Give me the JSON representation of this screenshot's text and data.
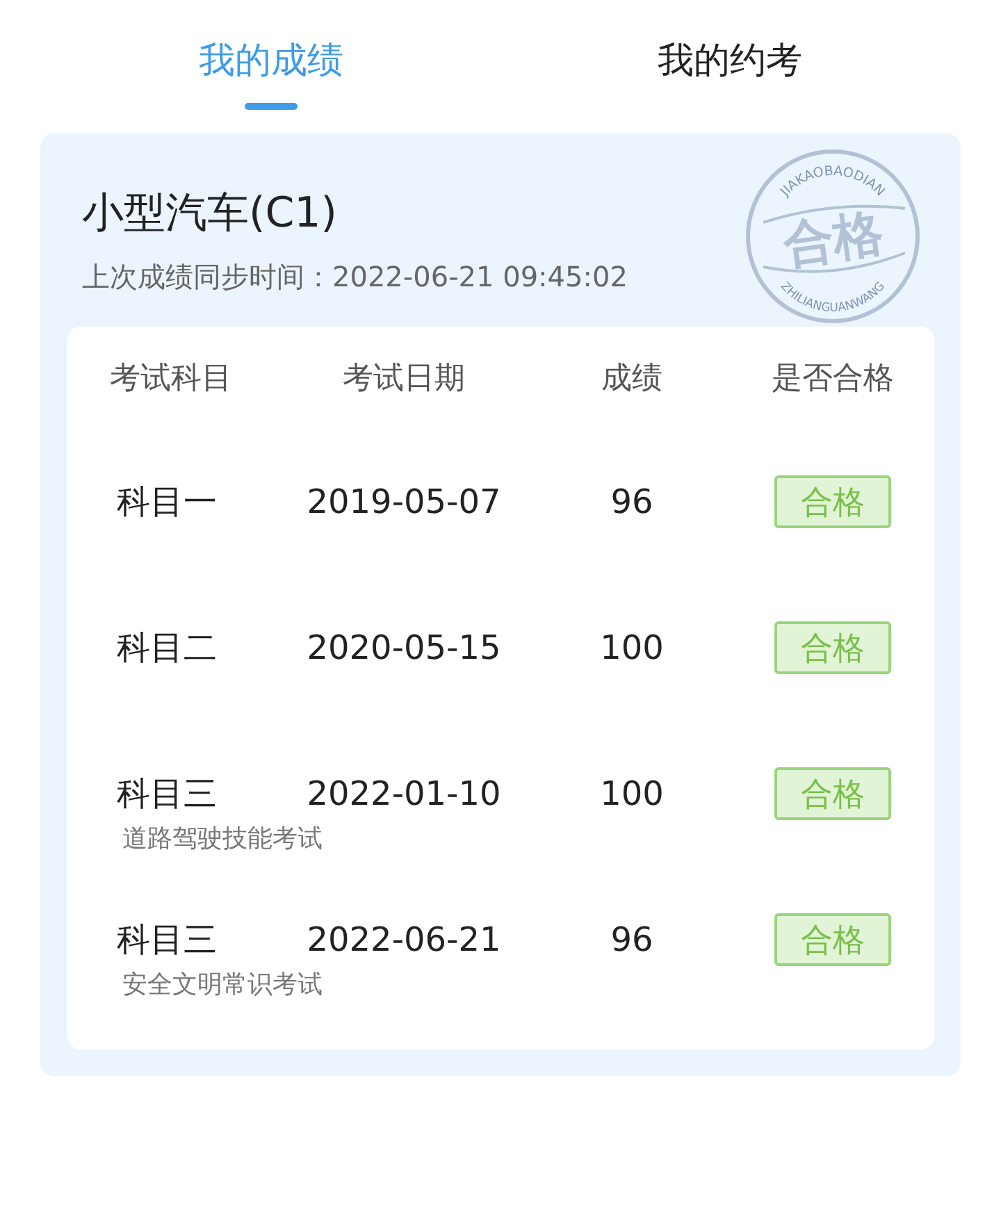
{
  "tabs": [
    {
      "label": "我的成绩",
      "selected": true
    },
    {
      "label": "我的约考",
      "selected": false
    }
  ],
  "card": {
    "title": "小型汽车(C1)",
    "sync_text": "上次成绩同步时间：2022-06-21 09:45:02",
    "stamp": {
      "top_text": "JIAKAOBAODIAN",
      "center_text": "合格",
      "bottom_text": "ZHILIANGUANWANG"
    }
  },
  "table": {
    "columns": [
      "考试科目",
      "考试日期",
      "成绩",
      "是否合格"
    ],
    "rows": [
      {
        "subject": "科目一",
        "date": "2019-05-07",
        "score": "96",
        "result": "合格",
        "passed": true
      },
      {
        "subject": "科目二",
        "date": "2020-05-15",
        "score": "100",
        "result": "合格",
        "passed": true
      },
      {
        "subject": "科目三",
        "note": "道路驾驶技能考试",
        "date": "2022-01-10",
        "score": "100",
        "result": "合格",
        "passed": true
      },
      {
        "subject": "科目三",
        "note": "安全文明常识考试",
        "date": "2022-06-21",
        "score": "96",
        "result": "合格",
        "passed": true
      }
    ]
  }
}
